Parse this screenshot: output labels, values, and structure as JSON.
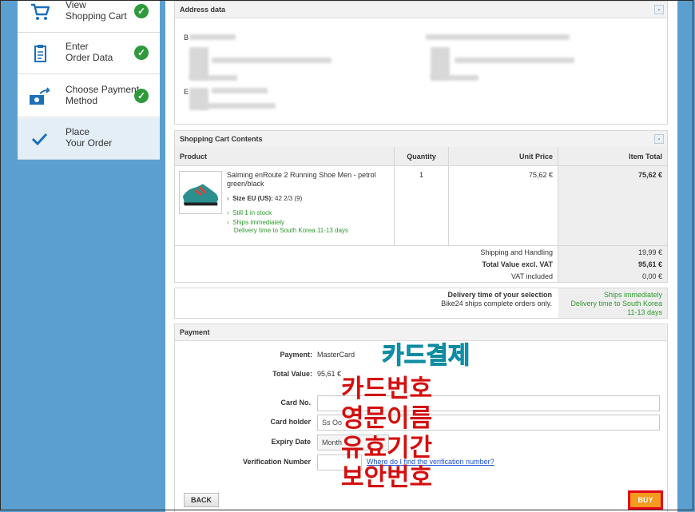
{
  "steps": [
    {
      "label1": "View",
      "label2": "Shopping Cart",
      "icon": "cart-icon",
      "done": true
    },
    {
      "label1": "Enter",
      "label2": "Order Data",
      "icon": "clipboard-icon",
      "done": true
    },
    {
      "label1": "Choose Payment",
      "label2": "Method",
      "icon": "payment-icon",
      "done": true
    },
    {
      "label1": "Place",
      "label2": "Your Order",
      "icon": "checkmark-icon",
      "done": false
    }
  ],
  "address": {
    "title": "Address data",
    "collapse": "-",
    "prefix1": "B",
    "prefix2": "E"
  },
  "cart": {
    "title": "Shopping Cart Contents",
    "collapse": "-",
    "headers": {
      "product": "Product",
      "quantity": "Quantity",
      "unit_price": "Unit Price",
      "item_total": "Item Total"
    },
    "item": {
      "name": "Salming enRoute 2 Running Shoe Men - petrol green/black",
      "size_label": "Size EU (US):",
      "size_value": "42 2/3 (9)",
      "stock": "Still 1 in stock",
      "ships": "Ships immediately",
      "delivery": "Delivery time to South Korea 11-13 days",
      "quantity": "1",
      "unit_price": "75,62 €",
      "item_total": "75,62 €"
    },
    "summary": [
      {
        "label": "Shipping and Handling",
        "value": "19,99 €",
        "bold": false
      },
      {
        "label": "Total Value excl. VAT",
        "value": "95,61 €",
        "bold": true
      },
      {
        "label": "VAT included",
        "value": "0,00 €",
        "bold": false
      }
    ]
  },
  "delivery": {
    "label": "Delivery time of your selection",
    "sub": "Bike24 ships complete orders only.",
    "value1": "Ships immediately",
    "value2": "Delivery time to South Korea",
    "value3": "11-13 days"
  },
  "payment": {
    "title": "Payment",
    "payment_label": "Payment:",
    "payment_value": "MasterCard",
    "total_label": "Total Value:",
    "total_value": "95,61 €",
    "card_no_label": "Card No.",
    "card_holder_label": "Card holder",
    "card_holder_value": "Ss Oo",
    "expiry_label": "Expiry Date",
    "expiry_value": "Month",
    "verification_label": "Verification Number",
    "verification_link": "Where do I find the verification number?"
  },
  "buttons": {
    "back": "BACK",
    "buy": "BUY"
  },
  "annotations": {
    "card_payment": "카드결제",
    "card_number": "카드번호",
    "english_name": "영문이름",
    "expiry": "유효기간",
    "security_code": "보안번호"
  },
  "colors": {
    "accent_blue": "#5b9fd0",
    "green": "#2e9a2e",
    "buy_orange": "#f39a1f",
    "highlight_red": "#e3061a",
    "annotation_cyan": "#17b6cf",
    "annotation_red": "#d40f0f"
  }
}
